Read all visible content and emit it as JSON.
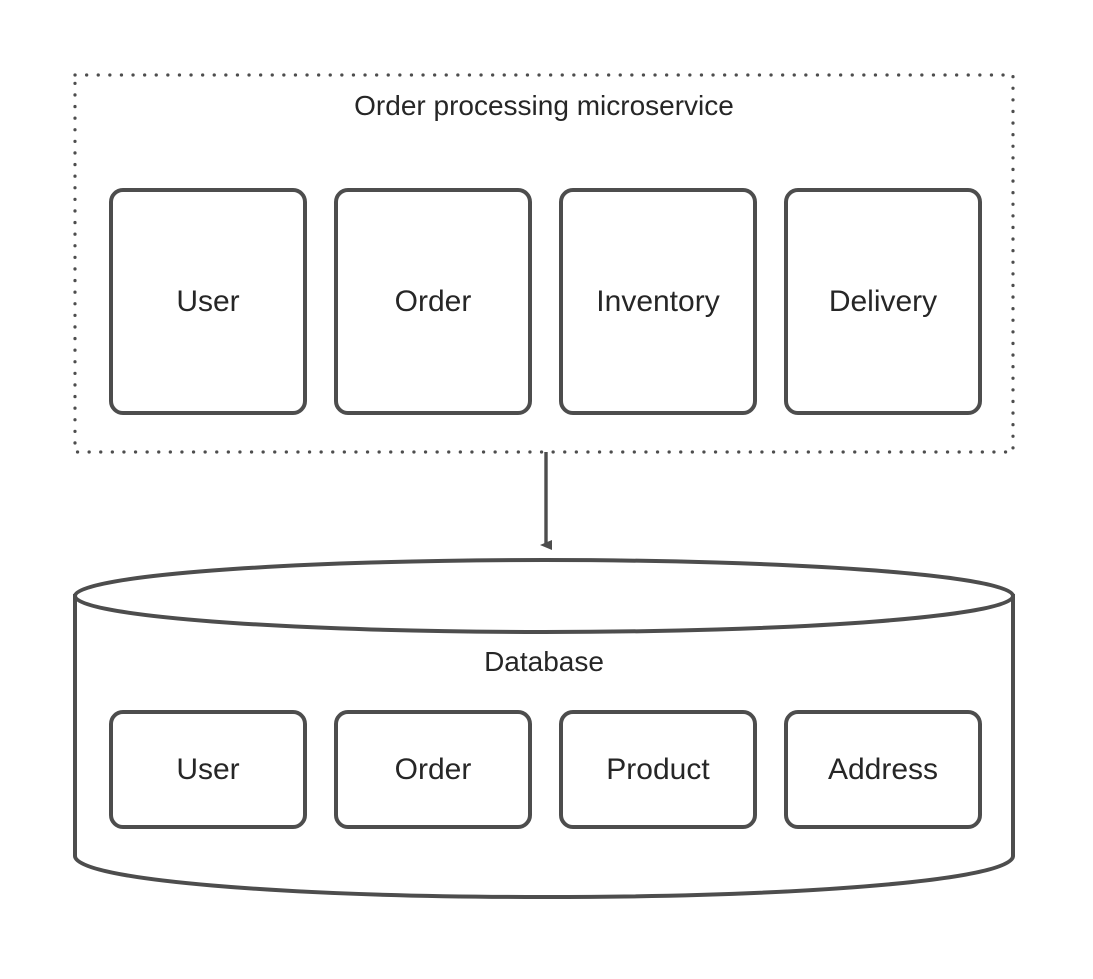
{
  "diagram": {
    "type": "architecture-diagram",
    "background_color": "#ffffff",
    "stroke_color": "#4d4d4d",
    "text_color": "#262626",
    "fill_color": "#ffffff"
  },
  "microservice_group": {
    "title": "Order processing microservice",
    "border_style": "dotted",
    "components": [
      {
        "label": "User"
      },
      {
        "label": "Order"
      },
      {
        "label": "Inventory"
      },
      {
        "label": "Delivery"
      }
    ]
  },
  "connector": {
    "name": "microservice-to-database-arrow",
    "direction": "down",
    "label": ""
  },
  "database": {
    "title": "Database",
    "shape": "cylinder",
    "tables": [
      {
        "label": "User"
      },
      {
        "label": "Order"
      },
      {
        "label": "Product"
      },
      {
        "label": "Address"
      }
    ]
  }
}
